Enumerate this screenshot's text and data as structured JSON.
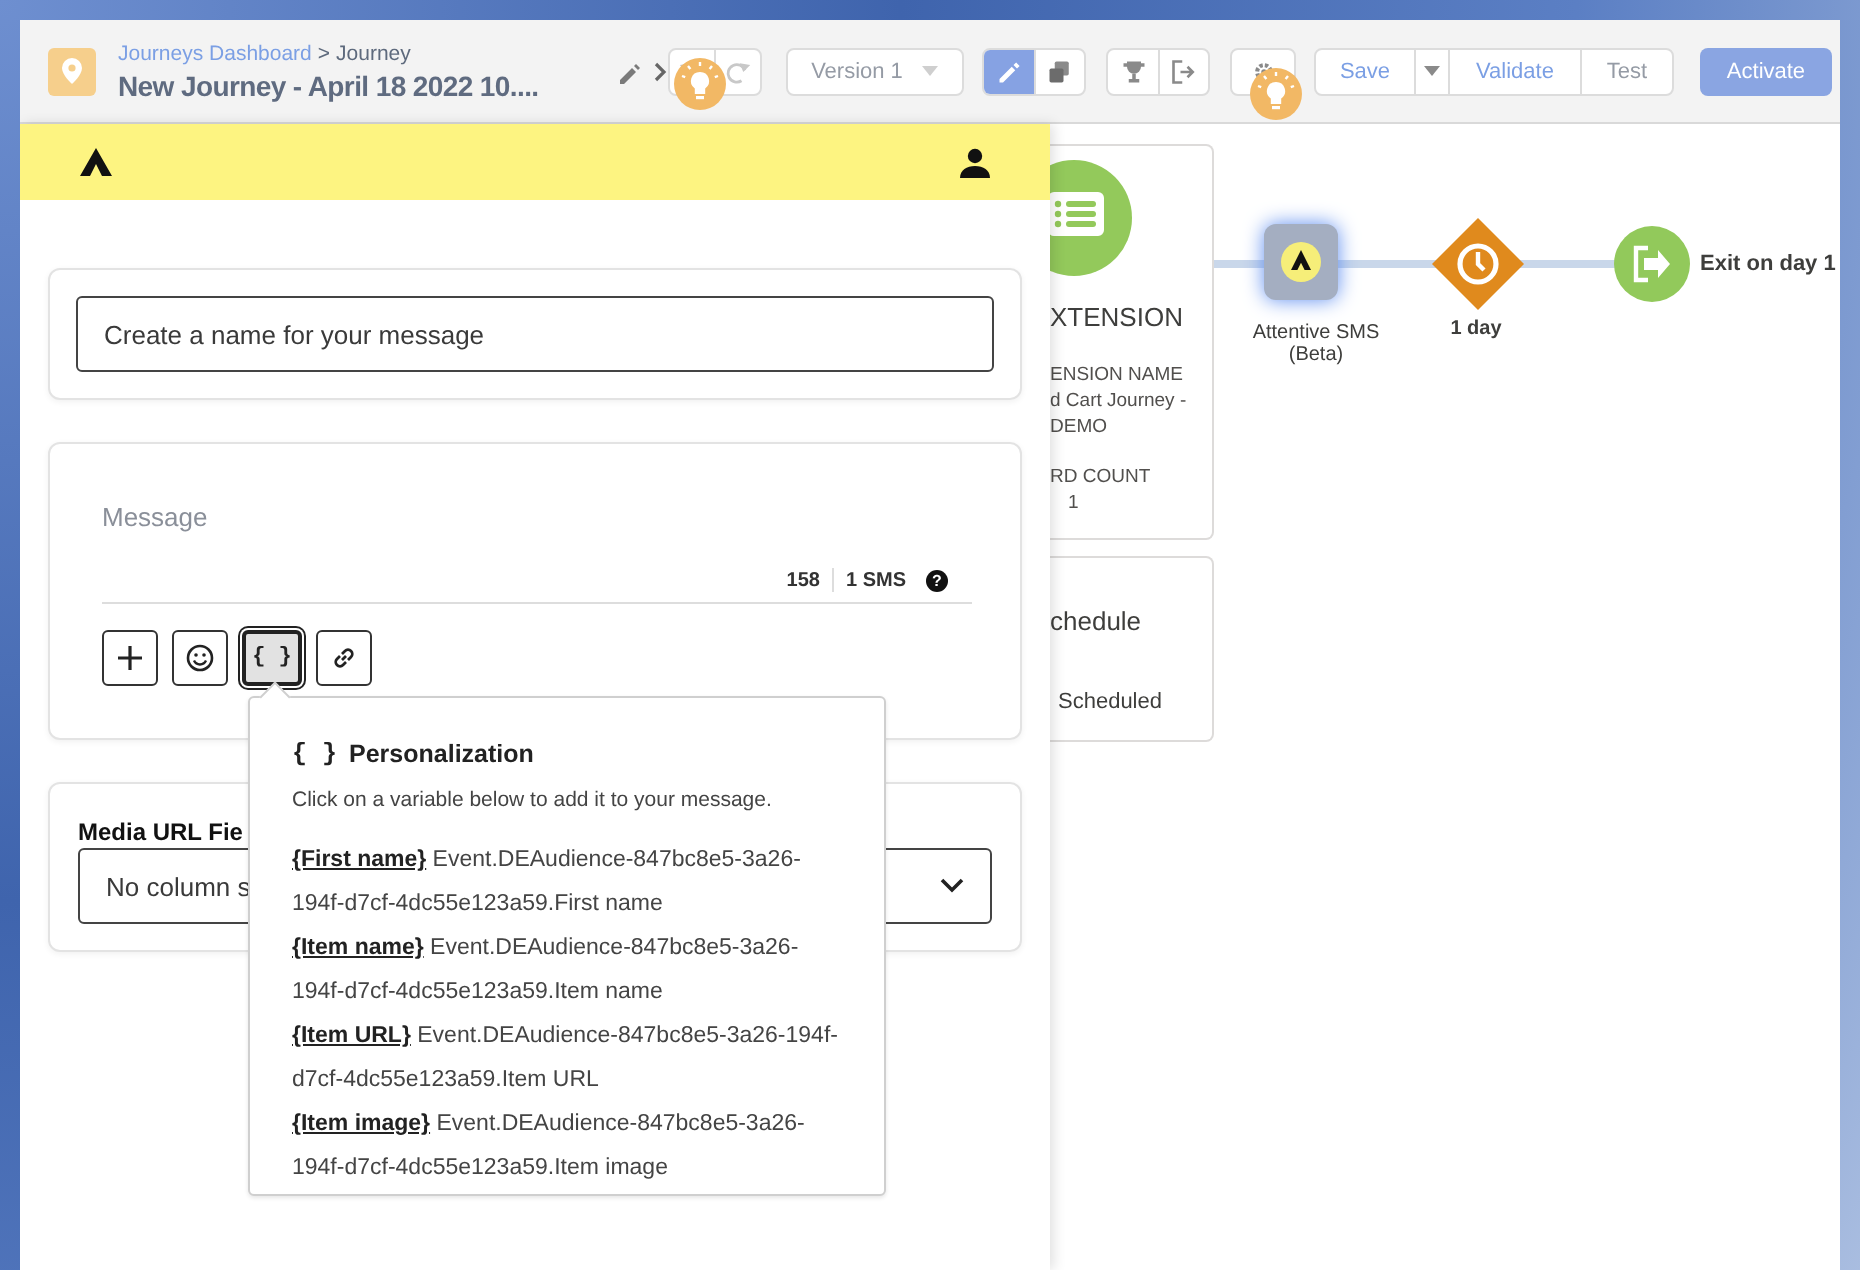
{
  "header": {
    "breadcrumb": [
      {
        "label": "Journeys Dashboard",
        "kind": "link"
      },
      {
        "label": "Journey",
        "kind": "current"
      }
    ],
    "separator": ">",
    "title": "New Journey - April 18 2022 10....",
    "history": [
      {
        "kind": "undo",
        "disabled": true
      },
      {
        "kind": "redo",
        "disabled": true
      }
    ],
    "version": {
      "label": "Version 1",
      "disabled": true
    },
    "modes": [
      {
        "kind": "edit",
        "selected": true
      },
      {
        "kind": "copy",
        "selected": false
      }
    ],
    "tools": [
      {
        "kind": "goal"
      },
      {
        "kind": "exit"
      }
    ],
    "actions": [
      {
        "kind": "text",
        "label": "Save",
        "disabled": false
      },
      {
        "kind": "caret",
        "disabled": false
      },
      {
        "kind": "text",
        "label": "Validate",
        "disabled": false
      },
      {
        "kind": "text",
        "label": "Test",
        "disabled": true
      }
    ],
    "activate": "Activate"
  },
  "canvas": {
    "cards": [
      {
        "kind": "event",
        "lines": [
          {
            "kind": "heading",
            "text": "XTENSION"
          },
          {
            "kind": "label",
            "text": "ENSION NAME"
          },
          {
            "kind": "value",
            "text": "d Cart Journey -"
          },
          {
            "kind": "value",
            "text": "DEMO"
          },
          {
            "kind": "label",
            "text": "RD COUNT"
          },
          {
            "kind": "count",
            "text": "1"
          }
        ]
      },
      {
        "kind": "schedule",
        "lines": [
          {
            "kind": "heading",
            "text": "chedule"
          },
          {
            "kind": "status",
            "text": "Scheduled"
          }
        ]
      }
    ],
    "nodes": [
      {
        "kind": "sms",
        "label": "Attentive SMS (Beta)",
        "selected": true
      },
      {
        "kind": "wait",
        "label": "1 day",
        "selected": false
      },
      {
        "kind": "exit",
        "label": "Exit on day 1",
        "selected": false
      }
    ]
  },
  "panel": {
    "name_field": {
      "placeholder": "Create a name for your message"
    },
    "message": {
      "placeholder": "Message",
      "char_count": "158",
      "segments": "1 SMS",
      "help": "?"
    },
    "tools": [
      {
        "kind": "plus",
        "selected": false
      },
      {
        "kind": "emoji",
        "selected": false
      },
      {
        "kind": "variables",
        "label": "{ }",
        "selected": true
      },
      {
        "kind": "link",
        "selected": false
      }
    ],
    "media_url": {
      "label": "Media URL Fie",
      "value": "No column s"
    },
    "personalization": {
      "icon_text": "{ }",
      "title": "Personalization",
      "hint": "Click on a variable below to add it to your message.",
      "variables": [
        {
          "token": "{First name}",
          "path": "Event.DEAudience-847bc8e5-3a26-194f-d7cf-4dc55e123a59.First name"
        },
        {
          "token": "{Item name}",
          "path": "Event.DEAudience-847bc8e5-3a26-194f-d7cf-4dc55e123a59.Item name"
        },
        {
          "token": "{Item URL}",
          "path": "Event.DEAudience-847bc8e5-3a26-194f-d7cf-4dc55e123a59.Item URL"
        },
        {
          "token": "{Item image}",
          "path": "Event.DEAudience-847bc8e5-3a26-194f-d7cf-4dc55e123a59.Item image"
        }
      ]
    }
  }
}
